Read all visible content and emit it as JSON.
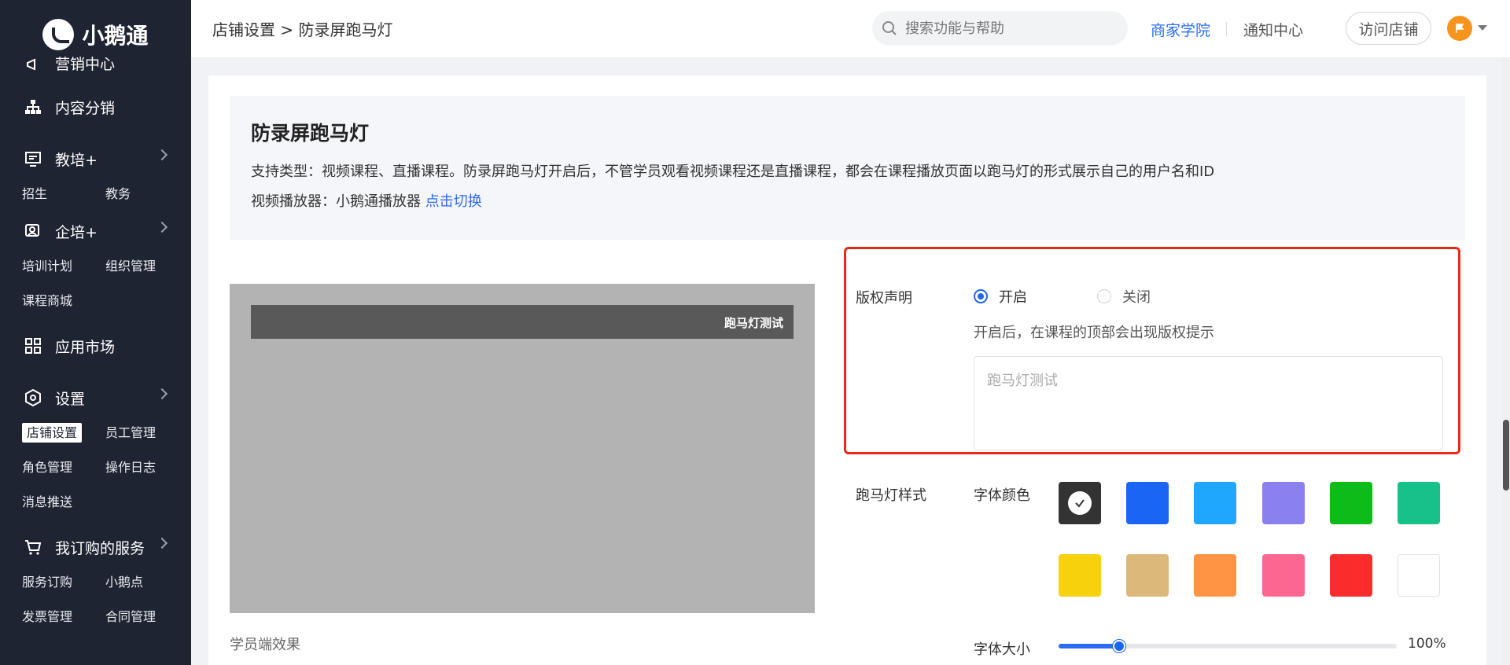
{
  "app": {
    "logo_text": "小鹅通"
  },
  "sidebar": {
    "partial_top": "营销中心",
    "groups": [
      {
        "label": "内容分销",
        "icon": "sitemap-icon",
        "has_arrow": false
      },
      {
        "label": "教培+",
        "icon": "screen-icon",
        "has_arrow": true,
        "subs": [
          "招生",
          "教务"
        ]
      },
      {
        "label": "企培+",
        "icon": "user-card-icon",
        "has_arrow": true,
        "subs": [
          "培训计划",
          "组织管理",
          "课程商城"
        ]
      },
      {
        "label": "应用市场",
        "icon": "grid-icon",
        "has_arrow": false
      },
      {
        "label": "设置",
        "icon": "hexagon-icon",
        "has_arrow": true,
        "subs": [
          "店铺设置",
          "员工管理",
          "角色管理",
          "操作日志",
          "消息推送"
        ],
        "active_sub": "店铺设置"
      },
      {
        "label": "我订购的服务",
        "icon": "cart-icon",
        "has_arrow": true,
        "subs": [
          "服务订购",
          "小鹅点",
          "发票管理",
          "合同管理"
        ]
      }
    ]
  },
  "header": {
    "breadcrumb": "店铺设置 > 防录屏跑马灯",
    "search_placeholder": "搜索功能与帮助",
    "link_academy": "商家学院",
    "link_notice": "通知中心",
    "visit_store": "访问店铺"
  },
  "info": {
    "title": "防录屏跑马灯",
    "description": "支持类型：视频课程、直播课程。防录屏跑马灯开启后，不管学员观看视频课程还是直播课程，都会在课程播放页面以跑马灯的形式展示自己的用户名和ID",
    "player_prefix": "视频播放器：小鹅通播放器 ",
    "player_switch": "点击切换"
  },
  "preview": {
    "marquee_text": "跑马灯测试",
    "caption": "学员端效果"
  },
  "copyright": {
    "label": "版权声明",
    "option_on": "开启",
    "option_off": "关闭",
    "selected": "开启",
    "hint": "开启后，在课程的顶部会出现版权提示",
    "text_value": "跑马灯测试"
  },
  "style": {
    "label": "跑马灯样式",
    "font_color_label": "字体颜色",
    "colors": [
      "#333333",
      "#1b65f5",
      "#1ea7fd",
      "#8a80f0",
      "#0dbb19",
      "#18c08a",
      "#f7d10c",
      "#ddb87b",
      "#ff9444",
      "#fc6791",
      "#fb2c2c",
      "#ffffff"
    ],
    "selected_color_index": 0,
    "font_size_label": "字体大小",
    "font_size_value": "100%",
    "font_size_fraction": 0.18
  }
}
